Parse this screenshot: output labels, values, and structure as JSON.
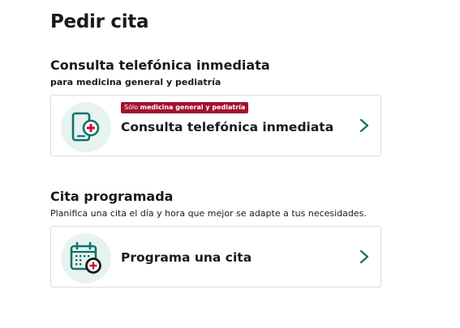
{
  "page": {
    "title": "Pedir cita"
  },
  "immediate": {
    "heading": "Consulta telefónica inmediata",
    "subheading": "para medicina general y pediatría",
    "card": {
      "badge_prefix": "Sólo ",
      "badge_bold": "medicina general y pediatría",
      "label": "Consulta telefónica inmediata",
      "icon": "phone-medical-icon"
    }
  },
  "scheduled": {
    "heading": "Cita programada",
    "subheading": "Planifica una cita el día y hora que mejor se adapte a tus necesidades.",
    "card": {
      "label": "Programa una cita",
      "icon": "calendar-medical-icon"
    }
  },
  "colors": {
    "accent": "#12706a",
    "icon_bg": "#e6f3ef",
    "badge_bg": "#a3122c",
    "medical_red": "#c8102e",
    "border": "#dcdcdc"
  }
}
